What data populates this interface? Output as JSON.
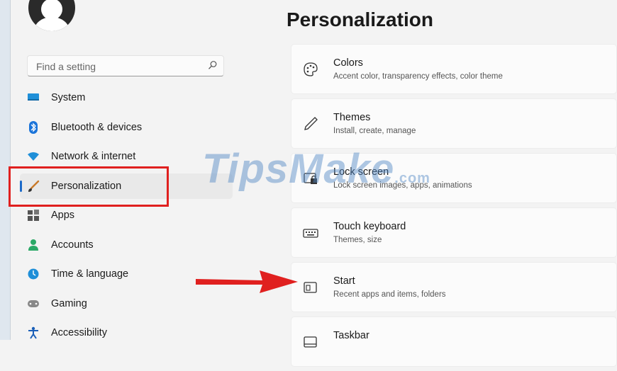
{
  "header": {
    "title": "Personalization"
  },
  "search": {
    "placeholder": "Find a setting"
  },
  "sidebar": {
    "items": [
      {
        "label": "System",
        "icon": "monitor-icon"
      },
      {
        "label": "Bluetooth & devices",
        "icon": "bluetooth-icon"
      },
      {
        "label": "Network & internet",
        "icon": "wifi-icon"
      },
      {
        "label": "Personalization",
        "icon": "paintbrush-icon",
        "selected": true
      },
      {
        "label": "Apps",
        "icon": "apps-icon"
      },
      {
        "label": "Accounts",
        "icon": "person-icon"
      },
      {
        "label": "Time & language",
        "icon": "globe-clock-icon"
      },
      {
        "label": "Gaming",
        "icon": "gamepad-icon"
      },
      {
        "label": "Accessibility",
        "icon": "accessibility-icon"
      }
    ]
  },
  "cards": [
    {
      "title": "Colors",
      "subtitle": "Accent color, transparency effects, color theme",
      "icon": "palette-icon"
    },
    {
      "title": "Themes",
      "subtitle": "Install, create, manage",
      "icon": "pen-icon"
    },
    {
      "title": "Lock screen",
      "subtitle": "Lock screen images, apps, animations",
      "icon": "lock-screen-icon"
    },
    {
      "title": "Touch keyboard",
      "subtitle": "Themes, size",
      "icon": "keyboard-icon"
    },
    {
      "title": "Start",
      "subtitle": "Recent apps and items, folders",
      "icon": "start-icon"
    },
    {
      "title": "Taskbar",
      "subtitle": "",
      "icon": "taskbar-icon"
    }
  ],
  "watermark": {
    "brand": "TipsMake",
    "suffix": ".com"
  },
  "colors": {
    "accent": "#1b6ac9",
    "highlight": "#e0201f"
  }
}
